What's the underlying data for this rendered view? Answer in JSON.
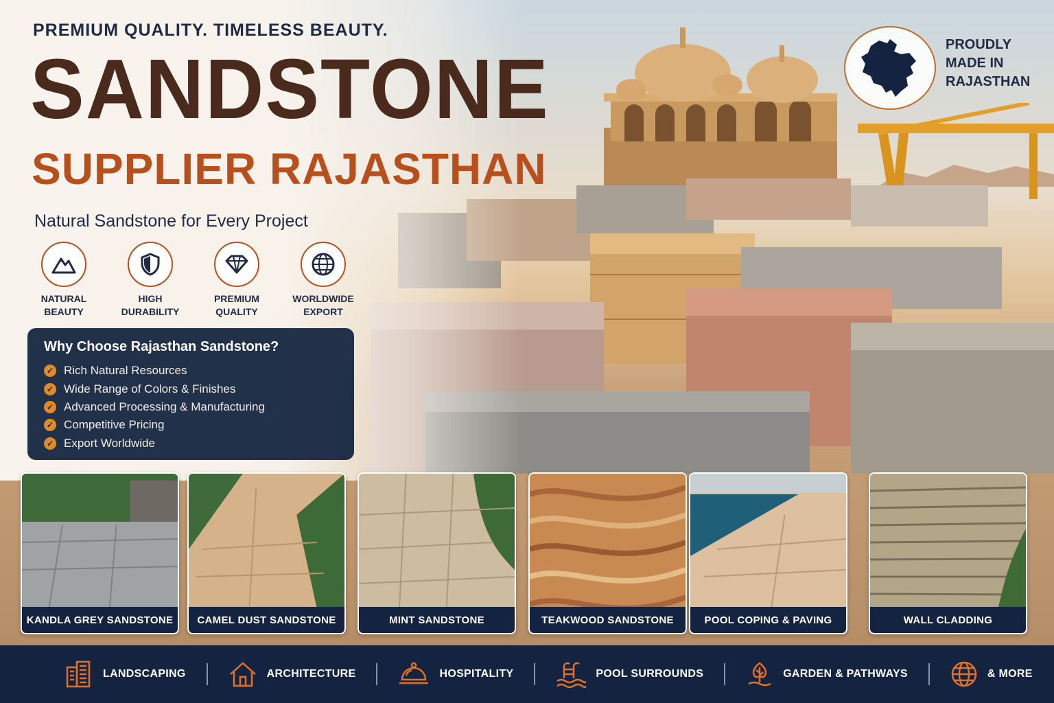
{
  "hero": {
    "tagline": "PREMIUM QUALITY. TIMELESS BEAUTY.",
    "title_line1": "SANDSTONE",
    "title_line2": "SUPPLIER RAJASTHAN",
    "subtitle": "Natural Sandstone for Every Project"
  },
  "features": [
    {
      "icon": "mountain-icon",
      "label": "NATURAL\nBEAUTY"
    },
    {
      "icon": "shield-icon",
      "label": "HIGH\nDURABILITY"
    },
    {
      "icon": "diamond-icon",
      "label": "PREMIUM\nQUALITY"
    },
    {
      "icon": "globe-icon",
      "label": "WORLDWIDE\nEXPORT"
    }
  ],
  "why": {
    "title": "Why Choose Rajasthan Sandstone?",
    "items": [
      "Rich Natural Resources",
      "Wide Range of Colors & Finishes",
      "Advanced Processing & Manufacturing",
      "Competitive Pricing",
      "Export Worldwide"
    ]
  },
  "badge": {
    "text": "PROUDLY MADE IN RAJASTHAN",
    "icon": "rajasthan-map-icon"
  },
  "products": [
    {
      "label": "KANDLA GREY SANDSTONE"
    },
    {
      "label": "CAMEL DUST SANDSTONE"
    },
    {
      "label": "MINT SANDSTONE"
    },
    {
      "label": "TEAKWOOD SANDSTONE"
    },
    {
      "label": "POOL COPING & PAVING"
    },
    {
      "label": "WALL CLADDING"
    }
  ],
  "footer": [
    {
      "icon": "building-icon",
      "label": "LANDSCAPING"
    },
    {
      "icon": "house-icon",
      "label": "ARCHITECTURE"
    },
    {
      "icon": "cloche-icon",
      "label": "HOSPITALITY"
    },
    {
      "icon": "pool-ladder-icon",
      "label": "POOL SURROUNDS"
    },
    {
      "icon": "tree-icon",
      "label": "GARDEN & PATHWAYS"
    },
    {
      "icon": "globe-icon",
      "label": "& MORE"
    }
  ],
  "colors": {
    "navy": "#142440",
    "brown": "#4a2a1c",
    "rust": "#b8501e",
    "accent_orange": "#e08a2a"
  }
}
